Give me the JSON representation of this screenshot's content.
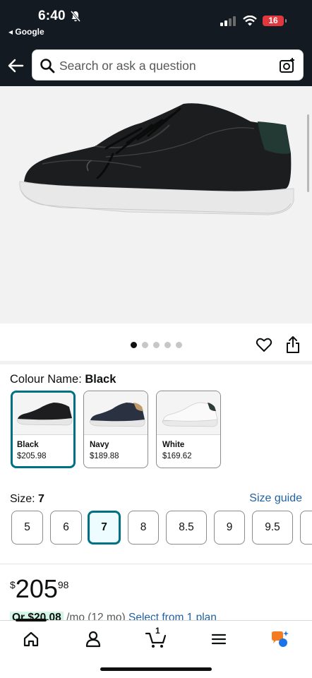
{
  "status_bar": {
    "time": "6:40",
    "back_app": "◂ Google",
    "battery": "16"
  },
  "header": {
    "search_placeholder": "Search or ask a question"
  },
  "carousel": {
    "total_images": 5,
    "active_index": 0
  },
  "colour": {
    "label": "Colour Name: ",
    "selected_value": "Black",
    "options": [
      {
        "name": "Black",
        "price": "$205.98",
        "selected": true
      },
      {
        "name": "Navy",
        "price": "$189.88",
        "selected": false
      },
      {
        "name": "White",
        "price": "$169.62",
        "selected": false
      }
    ]
  },
  "size": {
    "label": "Size: ",
    "selected_value": "7",
    "guide_link": "Size guide",
    "options": [
      "5",
      "6",
      "7",
      "8",
      "8.5",
      "9",
      "9.5"
    ]
  },
  "price": {
    "symbol": "$",
    "whole": "205",
    "fraction": "98"
  },
  "plan": {
    "badge": "Or $20.08",
    "per_month": " /mo (12 mo) ",
    "link": "Select from 1 plan"
  },
  "tab_bar": {
    "cart_count": "1",
    "items": [
      "home-tab",
      "account-tab",
      "cart-tab",
      "menu-tab",
      "rufus-tab"
    ]
  },
  "colors": {
    "header_bg": "#131a22",
    "selected_border": "#007185",
    "link": "#2162a1",
    "battery": "#e0383e"
  }
}
